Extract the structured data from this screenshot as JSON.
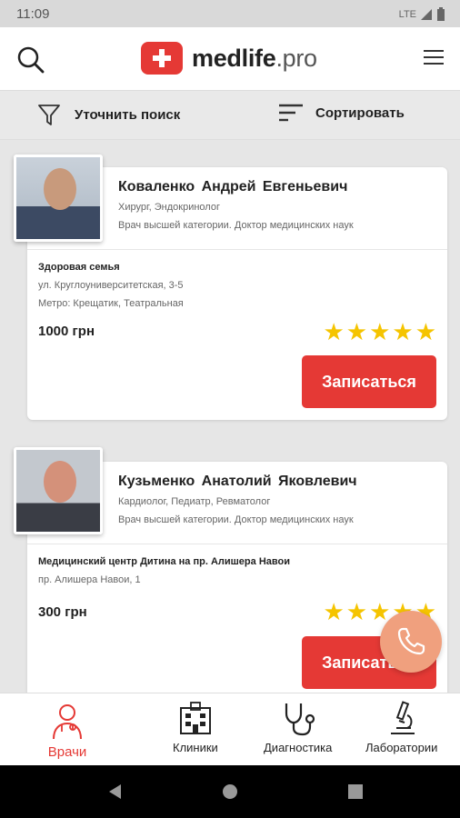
{
  "status": {
    "time": "11:09",
    "network": "LTE"
  },
  "header": {
    "logo_main": "medlife",
    "logo_sub": ".pro"
  },
  "filters": {
    "refine_label": "Уточнить поиск",
    "sort_label": "Сортировать"
  },
  "doctors": [
    {
      "name": "Коваленко Андрей Евгеньевич",
      "specialties": "Хирург, Эндокринолог",
      "degree": "Врач высшей категории. Доктор медицинских наук",
      "clinic": "Здоровая семья",
      "address": "ул. Круглоуниверситетская, 3-5",
      "metro": "Метро: Крещатик, Театральная",
      "price": "1000 грн",
      "rating": 5,
      "book_label": "Записаться"
    },
    {
      "name": "Кузьменко Анатолий Яковлевич",
      "specialties": "Кардиолог, Педиатр, Ревматолог",
      "degree": "Врач высшей категории. Доктор медицинских наук",
      "clinic": "Медицинский центр Дитина на пр. Алишера Навои",
      "address": "пр. Алишера Навои, 1",
      "price": "300 грн",
      "rating": 5,
      "book_label": "Записаться"
    }
  ],
  "bottom_nav": [
    {
      "label": "Врачи",
      "active": true
    },
    {
      "label": "Клиники",
      "active": false
    },
    {
      "label": "Диагностика",
      "active": false
    },
    {
      "label": "Лаборатории",
      "active": false
    }
  ],
  "colors": {
    "accent": "#e53935",
    "star": "#f5c400",
    "fab": "#f0a07e"
  }
}
